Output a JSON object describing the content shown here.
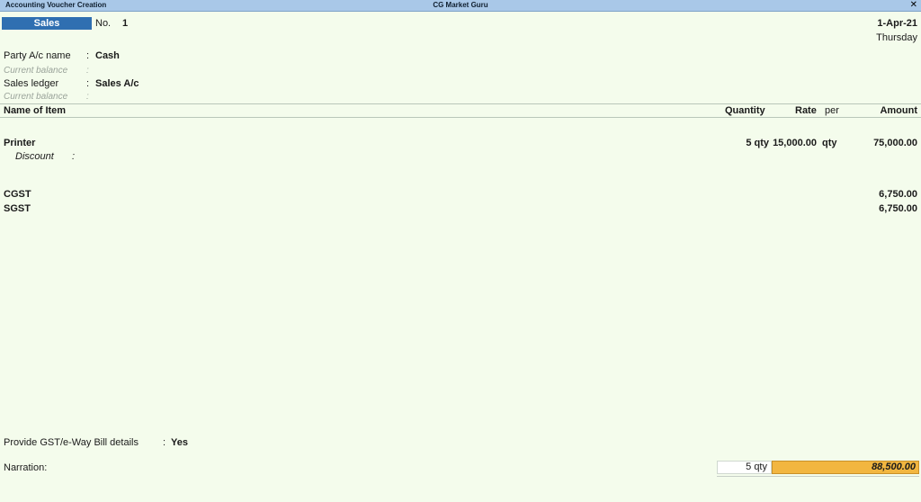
{
  "window": {
    "left_title": "Accounting Voucher Creation",
    "center_title": "CG Market Guru",
    "close_glyph": "✕"
  },
  "voucher": {
    "type": "Sales",
    "number_label": "No.",
    "number": "1",
    "date": "1-Apr-21",
    "day": "Thursday"
  },
  "party": {
    "label": "Party A/c name",
    "sep": ":",
    "value": "Cash",
    "current_balance_label": "Current balance",
    "current_balance_sep": ":"
  },
  "sales_ledger": {
    "label": "Sales ledger",
    "sep": ":",
    "value": "Sales A/c",
    "current_balance_label": "Current balance",
    "current_balance_sep": ":"
  },
  "table": {
    "headers": {
      "item": "Name of Item",
      "quantity": "Quantity",
      "rate": "Rate",
      "per": "per",
      "amount": "Amount"
    },
    "items": [
      {
        "name": "Printer",
        "quantity": "5 qty",
        "rate": "15,000.00",
        "per": "qty",
        "amount": "75,000.00",
        "discount_label": "Discount",
        "discount_sep": ":"
      }
    ],
    "taxes": [
      {
        "name": "CGST",
        "amount": "6,750.00"
      },
      {
        "name": "SGST",
        "amount": "6,750.00"
      }
    ]
  },
  "gst_details": {
    "label": "Provide GST/e-Way Bill details",
    "sep": ":",
    "value": "Yes"
  },
  "narration": {
    "label": "Narration:",
    "total_quantity": "5 qty",
    "total_amount": "88,500.00"
  },
  "colors": {
    "background": "#f4fcec",
    "titlebar": "#a9c8e8",
    "voucher_type_bg": "#2f6fb1",
    "total_amount_bg": "#f2b640"
  }
}
